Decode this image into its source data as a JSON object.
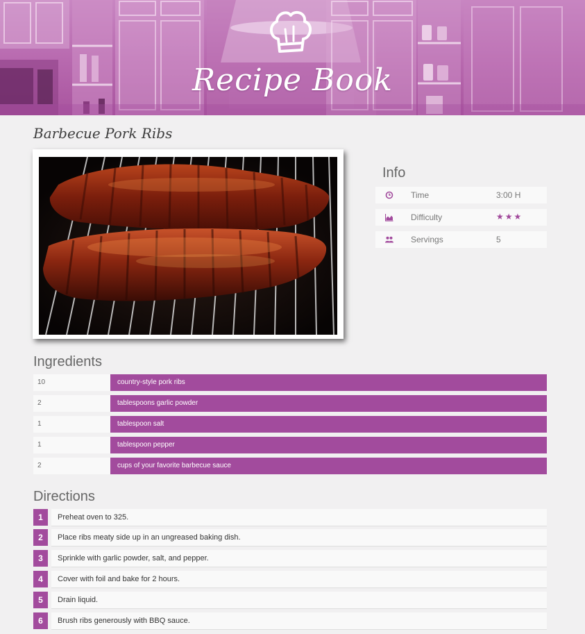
{
  "header": {
    "brand_title": "Recipe Book",
    "logo_icon": "chef-hat-icon",
    "background_color": "#b768ae"
  },
  "recipe": {
    "title": "Barbecue Pork Ribs",
    "photo": "barbecue-ribs-on-grill"
  },
  "info": {
    "heading": "Info",
    "rows": [
      {
        "icon": "clock-icon",
        "label": "Time",
        "value": "3:00 H"
      },
      {
        "icon": "area-chart-icon",
        "label": "Difficulty",
        "value": "",
        "stars": 3
      },
      {
        "icon": "users-icon",
        "label": "Servings",
        "value": "5"
      }
    ]
  },
  "ingredients": {
    "heading": "Ingredients",
    "items": [
      {
        "qty": "10",
        "name": "country-style pork ribs"
      },
      {
        "qty": "2",
        "name": "tablespoons garlic powder"
      },
      {
        "qty": "1",
        "name": "tablespoon salt"
      },
      {
        "qty": "1",
        "name": "tablespoon pepper"
      },
      {
        "qty": "2",
        "name": "cups of your favorite barbecue sauce"
      }
    ]
  },
  "directions": {
    "heading": "Directions",
    "steps": [
      {
        "num": "1",
        "text": "Preheat oven to 325."
      },
      {
        "num": "2",
        "text": "Place ribs meaty side up in an ungreased baking dish."
      },
      {
        "num": "3",
        "text": "Sprinkle with garlic powder, salt, and pepper."
      },
      {
        "num": "4",
        "text": "Cover with foil and bake for 2 hours."
      },
      {
        "num": "5",
        "text": "Drain liquid."
      },
      {
        "num": "6",
        "text": "Brush ribs generously with BBQ sauce."
      }
    ]
  },
  "colors": {
    "accent": "#a24b9d",
    "page_background": "#f1f0f1",
    "row_background": "#f9f9f9"
  }
}
